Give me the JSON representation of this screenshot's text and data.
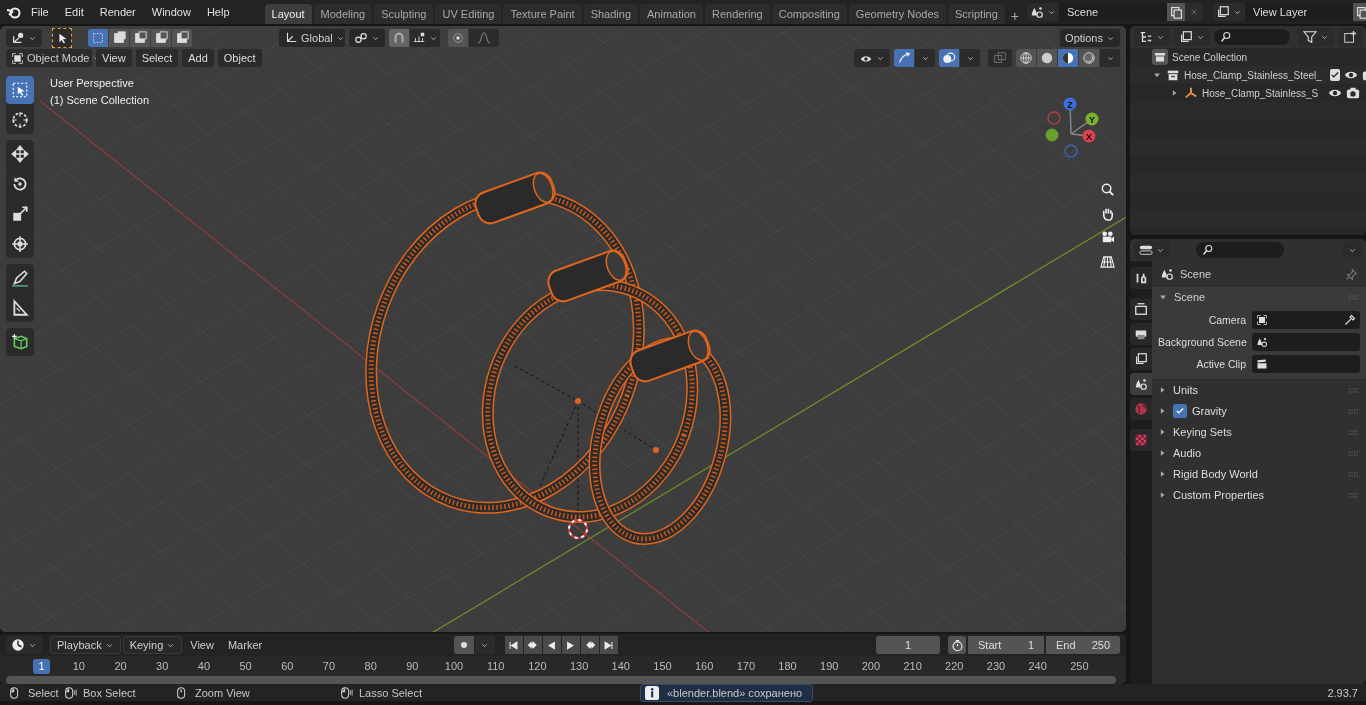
{
  "top_bar": {
    "menu": [
      "File",
      "Edit",
      "Render",
      "Window",
      "Help"
    ],
    "workspaces": [
      {
        "label": "Layout",
        "selected": true
      },
      {
        "label": "Modeling",
        "selected": false
      },
      {
        "label": "Sculpting",
        "selected": false
      },
      {
        "label": "UV Editing",
        "selected": false
      },
      {
        "label": "Texture Paint",
        "selected": false
      },
      {
        "label": "Shading",
        "selected": false
      },
      {
        "label": "Animation",
        "selected": false
      },
      {
        "label": "Rendering",
        "selected": false
      },
      {
        "label": "Compositing",
        "selected": false
      },
      {
        "label": "Geometry Nodes",
        "selected": false
      },
      {
        "label": "Scripting",
        "selected": false
      }
    ],
    "add_tab": "+",
    "scene": "Scene",
    "view_layer": "View Layer"
  },
  "viewport": {
    "select_modes": [
      {
        "selected": true
      },
      {
        "selected": false
      },
      {
        "selected": false
      },
      {
        "selected": false
      },
      {
        "selected": false
      }
    ],
    "orientation": "Global",
    "options": "Options",
    "mode": "Object Mode",
    "menus": [
      "View",
      "Select",
      "Add",
      "Object"
    ],
    "shading": [
      {
        "selected": false
      },
      {
        "selected": false
      },
      {
        "selected": true
      },
      {
        "selected": false
      }
    ],
    "info": [
      "User Perspective",
      "(1) Scene Collection"
    ],
    "gizmo": {
      "x": "X",
      "y": "Y",
      "z": "Z"
    },
    "tools": [
      {
        "kind": "select",
        "selected": true
      },
      {
        "kind": "cursor",
        "selected": false
      },
      {
        "kind": "move",
        "selected": false
      },
      {
        "kind": "rotate",
        "selected": false
      },
      {
        "kind": "scale",
        "selected": false
      },
      {
        "kind": "transform",
        "selected": false
      },
      {
        "kind": "annotate",
        "selected": false
      },
      {
        "kind": "measure",
        "selected": false
      },
      {
        "kind": "add_cube",
        "selected": false
      }
    ]
  },
  "outliner": {
    "root": "Scene Collection",
    "items": [
      {
        "label": "Hose_Clamp_Stainless_Steel_",
        "kind": "collection",
        "expanded": true,
        "checked": true,
        "children": [
          {
            "label": "Hose_Clamp_Stainless_S",
            "kind": "object",
            "expanded": false
          }
        ]
      }
    ]
  },
  "properties": {
    "tabs": [
      {
        "kind": "tool",
        "selected": false
      },
      {
        "kind": "render",
        "selected": false
      },
      {
        "kind": "output",
        "selected": false
      },
      {
        "kind": "view_layer",
        "selected": false
      },
      {
        "kind": "scene",
        "selected": true
      },
      {
        "kind": "world",
        "selected": false
      },
      {
        "kind": "texture",
        "selected": false
      }
    ],
    "context": "Scene",
    "panel": {
      "title": "Scene",
      "expanded": true,
      "fields": [
        {
          "label": "Camera",
          "kind": "camera"
        },
        {
          "label": "Background Scene",
          "kind": "scene"
        },
        {
          "label": "Active Clip",
          "kind": "clip"
        }
      ]
    },
    "sections": [
      {
        "title": "Units",
        "kind": "plain",
        "expanded": false
      },
      {
        "title": "Gravity",
        "kind": "checkbox",
        "checked": true,
        "expanded": false
      },
      {
        "title": "Keying Sets",
        "kind": "plain",
        "expanded": false
      },
      {
        "title": "Audio",
        "kind": "plain",
        "expanded": false
      },
      {
        "title": "Rigid Body World",
        "kind": "plain",
        "expanded": false
      },
      {
        "title": "Custom Properties",
        "kind": "plain",
        "expanded": false
      }
    ]
  },
  "timeline": {
    "menus": [
      {
        "label": "Playback",
        "kind": "dropdown"
      },
      {
        "label": "Keying",
        "kind": "dropdown"
      },
      {
        "label": "View",
        "kind": "plain"
      },
      {
        "label": "Marker",
        "kind": "plain"
      }
    ],
    "current_frame": "1",
    "start_label": "Start",
    "start": "1",
    "end_label": "End",
    "end": "250",
    "playhead": "1",
    "ruler": [
      "10",
      "20",
      "30",
      "40",
      "50",
      "60",
      "70",
      "80",
      "90",
      "100",
      "110",
      "120",
      "130",
      "140",
      "150",
      "160",
      "170",
      "180",
      "190",
      "200",
      "210",
      "220",
      "230",
      "240",
      "250"
    ]
  },
  "status_bar": {
    "hints": [
      {
        "label": "Select",
        "kind": "click"
      },
      {
        "label": "Box Select",
        "kind": "drag"
      },
      {
        "label": "Zoom View",
        "kind": "middle"
      },
      {
        "label": "Lasso Select",
        "kind": "drag"
      }
    ],
    "message": "«blender.blend» сохранено",
    "version": "2.93.7"
  }
}
